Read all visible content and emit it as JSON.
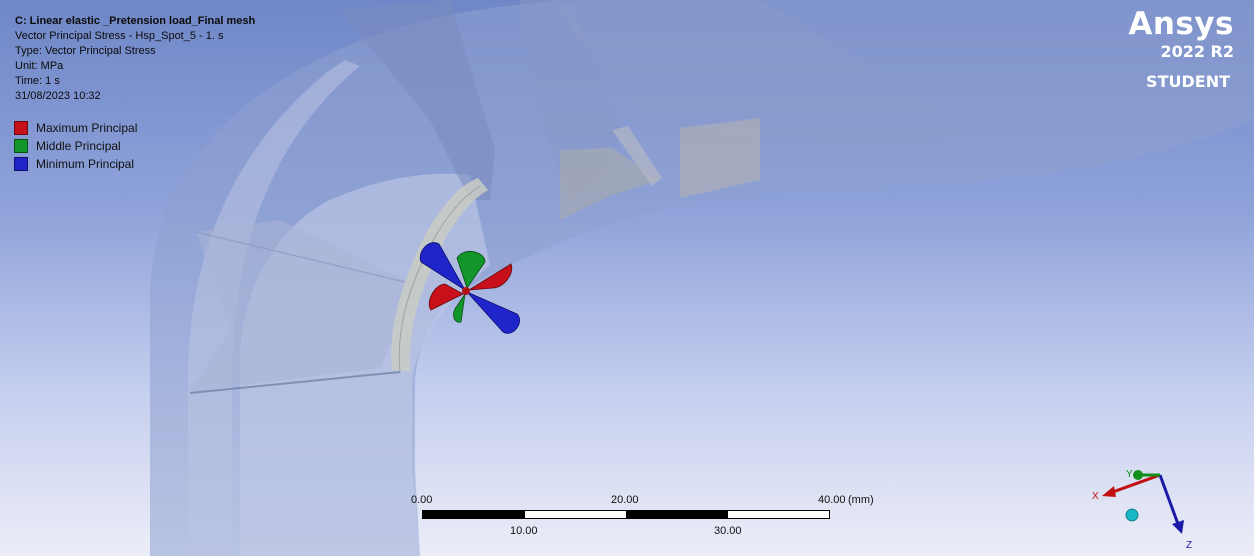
{
  "info": {
    "title": "C: Linear elastic _Pretension load_Final mesh",
    "result": "Vector Principal Stress - Hsp_Spot_5 - 1. s",
    "type": "Type: Vector Principal Stress",
    "unit": "Unit: MPa",
    "time": "Time: 1 s",
    "timestamp": "31/08/2023 10:32"
  },
  "legend": [
    {
      "label": "Maximum Principal",
      "color": "#c8101a"
    },
    {
      "label": "Middle Principal",
      "color": "#12962a"
    },
    {
      "label": "Minimum Principal",
      "color": "#1f23c8"
    }
  ],
  "brand": {
    "name": "Ansys",
    "version": "2022 R2",
    "edition": "STUDENT"
  },
  "scale": {
    "top_labels": [
      "0.00",
      "20.00",
      "40.00"
    ],
    "bottom_labels": [
      "10.00",
      "30.00"
    ],
    "unit": "(mm)"
  },
  "triad": {
    "x": "X",
    "y": "Y",
    "z": "Z"
  }
}
